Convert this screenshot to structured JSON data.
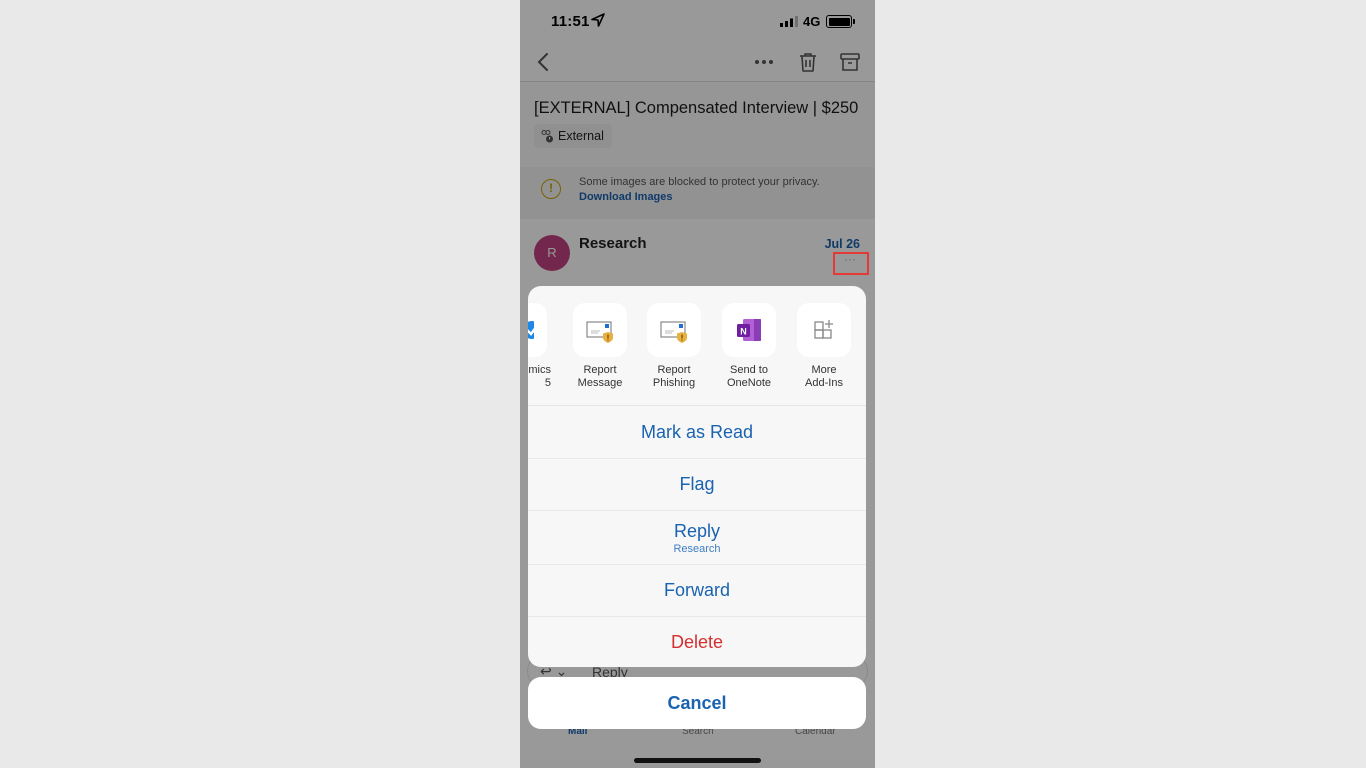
{
  "status_bar": {
    "time": "11:51",
    "network": "4G"
  },
  "nav": {
    "back_icon": "chevron-left-icon",
    "more_icon": "ellipsis-icon",
    "delete_icon": "trash-icon",
    "archive_icon": "archive-icon"
  },
  "email": {
    "subject": "[EXTERNAL] Compensated Interview | $250",
    "badge": "External",
    "privacy_notice": "Some images are blocked to protect your privacy.",
    "download_link": "Download Images",
    "sender_initial": "R",
    "sender": "Research",
    "date": "Jul 26",
    "more_label": "···"
  },
  "action_sheet": {
    "addins": [
      {
        "label": "mics\n5",
        "icon": "dynamics-check-icon"
      },
      {
        "label": "Report\nMessage",
        "icon": "report-message-icon"
      },
      {
        "label": "Report\nPhishing",
        "icon": "report-phishing-icon",
        "highlighted": true
      },
      {
        "label": "Send to\nOneNote",
        "icon": "onenote-icon"
      },
      {
        "label": "More\nAdd-Ins",
        "icon": "add-ins-icon"
      }
    ],
    "actions": [
      {
        "label": "Mark as Read"
      },
      {
        "label": "Flag"
      },
      {
        "label": "Reply",
        "sub": "Research"
      },
      {
        "label": "Forward"
      },
      {
        "label": "Delete",
        "color": "#d32f2f"
      }
    ],
    "cancel": "Cancel"
  },
  "reply_bar": {
    "label": "Reply"
  },
  "tabs": {
    "mail": "Mail",
    "search": "Search",
    "calendar": "Calendar"
  },
  "colors": {
    "accent": "#1a63b0",
    "destructive": "#d32f2f",
    "highlight": "#e53935",
    "avatar": "#c2417f"
  }
}
